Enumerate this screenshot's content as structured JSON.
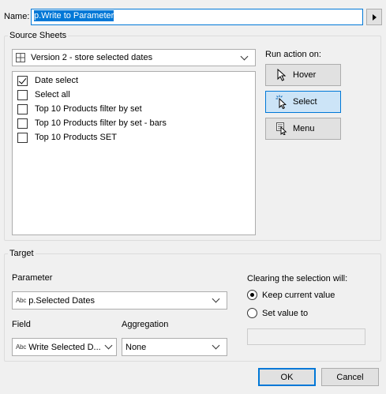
{
  "name": {
    "label": "Name:",
    "value": "p.Write to Parameter"
  },
  "source_sheets": {
    "title": "Source Sheets",
    "data_source": "Version 2 - store selected dates",
    "items": [
      {
        "label": "Date select",
        "checked": true
      },
      {
        "label": "Select all",
        "checked": false
      },
      {
        "label": "Top 10 Products filter by set",
        "checked": false
      },
      {
        "label": "Top 10 Products filter by set - bars",
        "checked": false
      },
      {
        "label": "Top 10 Products SET",
        "checked": false
      }
    ]
  },
  "run_action": {
    "title": "Run action on:",
    "hover_label": "Hover",
    "select_label": "Select",
    "menu_label": "Menu",
    "active": "Select"
  },
  "target": {
    "title": "Target",
    "parameter_label": "Parameter",
    "parameter_value": "p.Selected Dates",
    "field_label": "Field",
    "field_value": "Write Selected D...",
    "aggregation_label": "Aggregation",
    "aggregation_value": "None",
    "abc_tag": "Abc"
  },
  "clearing": {
    "title": "Clearing the selection will:",
    "keep_label": "Keep current value",
    "set_label": "Set value to",
    "selected": "keep"
  },
  "buttons": {
    "ok": "OK",
    "cancel": "Cancel"
  },
  "colors": {
    "accent": "#0078d7",
    "active_button": "#cce4f7",
    "dialog_bg": "#f0f0f0"
  }
}
